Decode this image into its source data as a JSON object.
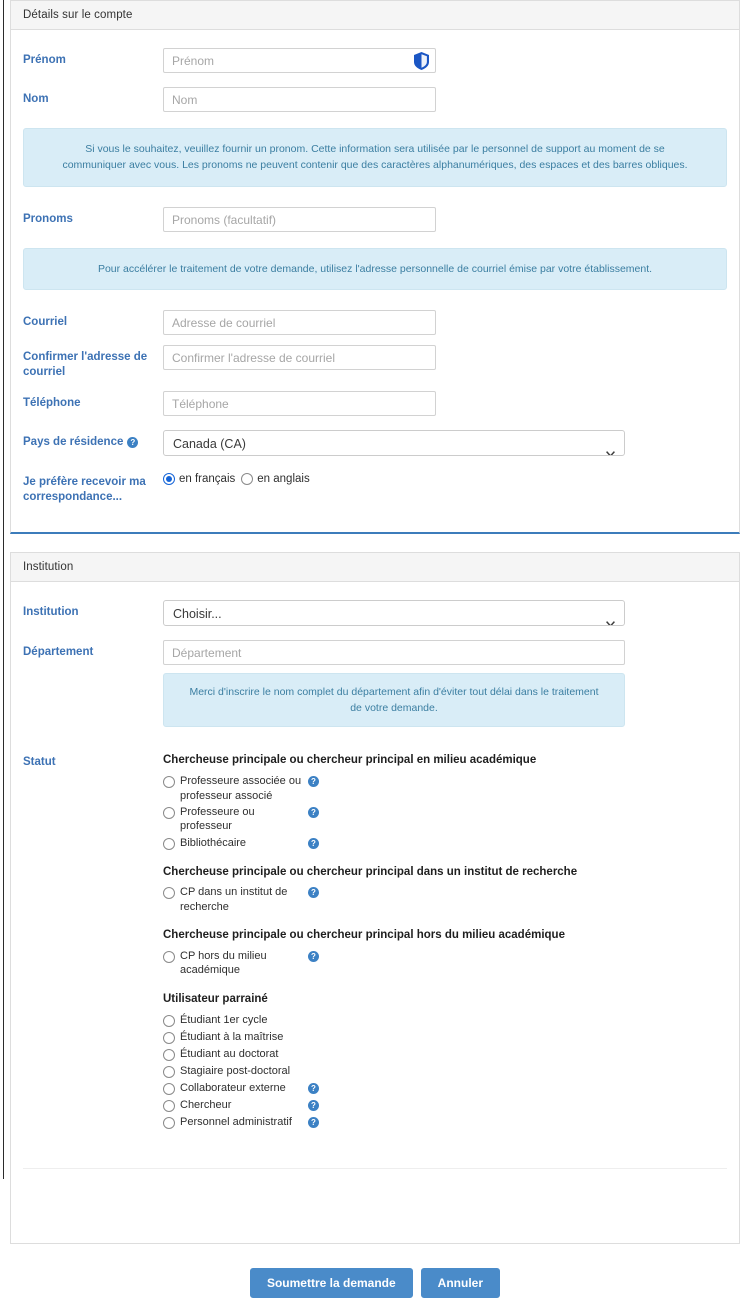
{
  "colors": {
    "label_blue": "#3d72b4",
    "info_bg": "#d9edf7",
    "info_text": "#3b7ea1",
    "button_blue": "#4a8bc9",
    "accent_border": "#3c7cbb",
    "radio_selected": "#1565d8",
    "help_badge": "#3c81c4"
  },
  "account_panel": {
    "header": "Détails sur le compte",
    "fields": {
      "first_name": {
        "label": "Prénom",
        "value": "",
        "placeholder": "Prénom",
        "icon": "shield-icon"
      },
      "last_name": {
        "label": "Nom",
        "value": "",
        "placeholder": "Nom"
      },
      "pronouns": {
        "label": "Pronoms",
        "value": "",
        "placeholder": "Pronoms (facultatif)"
      },
      "email": {
        "label": "Courriel",
        "value": "",
        "placeholder": "Adresse de courriel"
      },
      "email_confirm": {
        "label": "Confirmer l'adresse de courriel",
        "value": "",
        "placeholder": "Confirmer l'adresse de courriel"
      },
      "phone": {
        "label": "Téléphone",
        "value": "",
        "placeholder": "Téléphone"
      },
      "country": {
        "label": "Pays de résidence",
        "value": "Canada (CA)",
        "help": "?"
      },
      "correspondence": {
        "label": "Je préfère recevoir ma correspondance..."
      }
    },
    "info_pronouns": "Si vous le souhaitez, veuillez fournir un pronom. Cette information sera utilisée par le personnel de support au moment de se communiquer avec vous. Les pronoms ne peuvent contenir que des caractères alphanumériques, des espaces et des barres obliques.",
    "info_email": "Pour accélérer le traitement de votre demande, utilisez l'adresse personnelle de courriel émise par votre établissement.",
    "language_options": [
      {
        "label": "en français",
        "selected": true
      },
      {
        "label": "en anglais",
        "selected": false
      }
    ]
  },
  "institution_panel": {
    "header": "Institution",
    "fields": {
      "institution": {
        "label": "Institution",
        "value": "Choisir..."
      },
      "department": {
        "label": "Département",
        "value": "",
        "placeholder": "Département"
      },
      "status": {
        "label": "Statut"
      }
    },
    "info_department": "Merci d'inscrire le nom complet du département afin d'éviter tout délai dans le traitement de votre demande.",
    "status_groups": [
      {
        "title": "Chercheuse principale ou chercheur principal en milieu académique",
        "options": [
          {
            "label": "Professeure associée ou professeur associé",
            "selected": false,
            "help": "?"
          },
          {
            "label": "Professeure ou professeur",
            "selected": false,
            "help": "?"
          },
          {
            "label": "Bibliothécaire",
            "selected": false,
            "help": "?"
          }
        ]
      },
      {
        "title": "Chercheuse principale ou chercheur principal dans un institut de recherche",
        "options": [
          {
            "label": "CP dans un institut de recherche",
            "selected": false,
            "help": "?"
          }
        ]
      },
      {
        "title": "Chercheuse principale ou chercheur principal hors du milieu académique",
        "options": [
          {
            "label": "CP hors du milieu académique",
            "selected": false,
            "help": "?"
          }
        ]
      },
      {
        "title": "Utilisateur parrainé",
        "options": [
          {
            "label": "Étudiant 1er cycle",
            "selected": false,
            "help": ""
          },
          {
            "label": "Étudiant à la maîtrise",
            "selected": false,
            "help": ""
          },
          {
            "label": "Étudiant au doctorat",
            "selected": false,
            "help": ""
          },
          {
            "label": "Stagiaire post-doctoral",
            "selected": false,
            "help": ""
          },
          {
            "label": "Collaborateur externe",
            "selected": false,
            "help": "?"
          },
          {
            "label": "Chercheur",
            "selected": false,
            "help": "?"
          },
          {
            "label": "Personnel administratif",
            "selected": false,
            "help": "?"
          }
        ]
      }
    ]
  },
  "actions": {
    "submit": "Soumettre la demande",
    "cancel": "Annuler"
  }
}
